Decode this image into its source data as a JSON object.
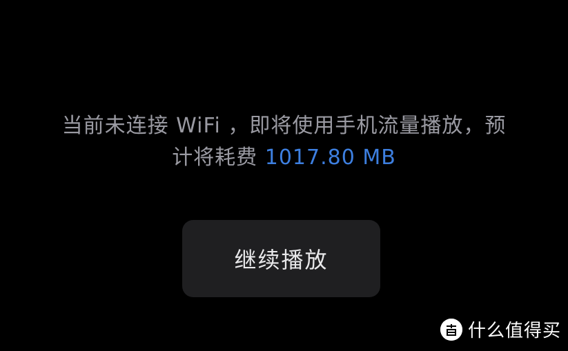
{
  "message": {
    "line1": "当前未连接 WiFi ，即将使用手机流量播放，预",
    "line2_prefix": "计将耗费 ",
    "line2_amount": "1017.80 MB"
  },
  "continue_button": {
    "label": "继续播放"
  },
  "watermark": {
    "logo_glyph": "值",
    "text": "什么值得买"
  },
  "colors": {
    "background": "#000000",
    "message_text": "#9a9aa2",
    "highlight": "#3d7fe0",
    "button_bg": "#1f1f21",
    "button_text": "#e8e8ea"
  }
}
